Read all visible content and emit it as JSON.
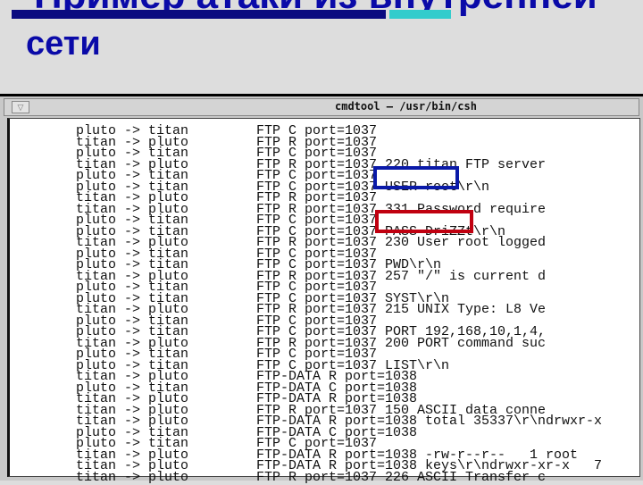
{
  "slide": {
    "title_line1": "Пример атаки из внутренней",
    "title_line2": "сети",
    "bar_colors": [
      "#0a0a80",
      "#33cccc"
    ]
  },
  "window": {
    "title": "cmdtool – /usr/bin/csh",
    "menu_icon": "triangle-down-icon"
  },
  "rows": [
    [
      "pluto -> titan",
      "FTP C port=1037"
    ],
    [
      "titan -> pluto",
      "FTP R port=1037"
    ],
    [
      "pluto -> titan",
      "FTP C port=1037"
    ],
    [
      "titan -> pluto",
      "FTP R port=1037 220 titan FTP server"
    ],
    [
      "pluto -> titan",
      "FTP C port=1037"
    ],
    [
      "pluto -> titan",
      "FTP C port=1037 USER root\\r\\n"
    ],
    [
      "titan -> pluto",
      "FTP R port=1037"
    ],
    [
      "titan -> pluto",
      "FTP R port=1037 331 Password require"
    ],
    [
      "pluto -> titan",
      "FTP C port=1037"
    ],
    [
      "pluto -> titan",
      "FTP C port=1037 PASS DriZZt\\r\\n"
    ],
    [
      "titan -> pluto",
      "FTP R port=1037 230 User root logged"
    ],
    [
      "pluto -> titan",
      "FTP C port=1037"
    ],
    [
      "pluto -> titan",
      "FTP C port=1037 PWD\\r\\n"
    ],
    [
      "titan -> pluto",
      "FTP R port=1037 257 \"/\" is current d"
    ],
    [
      "pluto -> titan",
      "FTP C port=1037"
    ],
    [
      "pluto -> titan",
      "FTP C port=1037 SYST\\r\\n"
    ],
    [
      "titan -> pluto",
      "FTP R port=1037 215 UNIX Type: L8 Ve"
    ],
    [
      "pluto -> titan",
      "FTP C port=1037"
    ],
    [
      "pluto -> titan",
      "FTP C port=1037 PORT 192,168,10,1,4,"
    ],
    [
      "titan -> pluto",
      "FTP R port=1037 200 PORT command suc"
    ],
    [
      "pluto -> titan",
      "FTP C port=1037"
    ],
    [
      "pluto -> titan",
      "FTP C port=1037 LIST\\r\\n"
    ],
    [
      "titan -> pluto",
      "FTP-DATA R port=1038"
    ],
    [
      "pluto -> titan",
      "FTP-DATA C port=1038"
    ],
    [
      "titan -> pluto",
      "FTP-DATA R port=1038"
    ],
    [
      "titan -> pluto",
      "FTP R port=1037 150 ASCII data conne"
    ],
    [
      "titan -> pluto",
      "FTP-DATA R port=1038 total 35337\\r\\ndrwxr-x"
    ],
    [
      "pluto -> titan",
      "FTP-DATA C port=1038"
    ],
    [
      "pluto -> titan",
      "FTP C port=1037"
    ],
    [
      "titan -> pluto",
      "FTP-DATA R port=1038 -rw-r--r--   1 root"
    ],
    [
      "titan -> pluto",
      "FTP-DATA R port=1038 keys\\r\\ndrwxr-xr-x   7"
    ],
    [
      "titan -> pluto",
      "FTP R port=1037 226 ASCII Transfer c"
    ]
  ],
  "highlights": {
    "user_box_color": "#0a1aa8",
    "pass_box_color": "#c00010"
  }
}
